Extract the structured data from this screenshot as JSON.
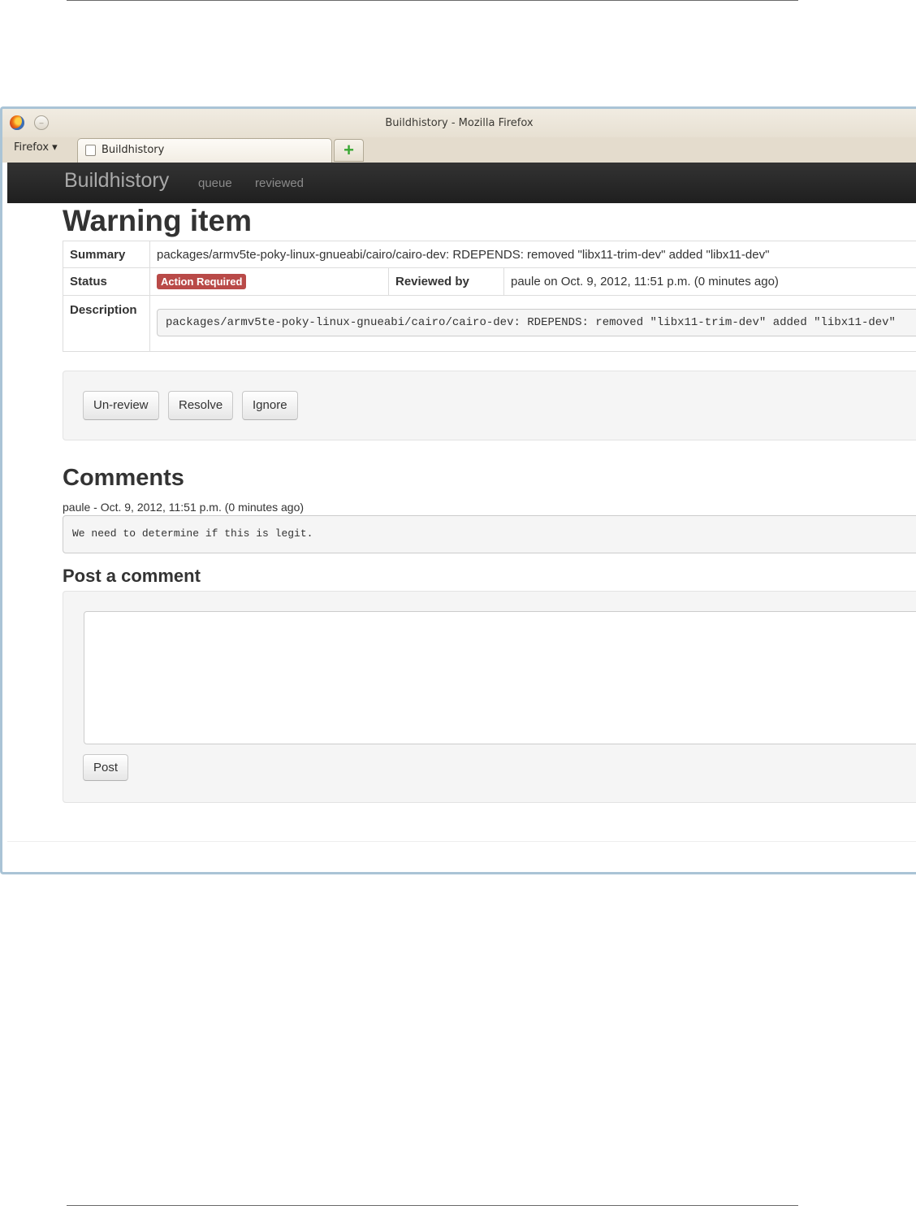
{
  "browser": {
    "window_title": "Buildhistory - Mozilla Firefox",
    "menu_label": "Firefox ▾",
    "tab_title": "Buildhistory",
    "new_tab_glyph": "+"
  },
  "navbar": {
    "brand": "Buildhistory",
    "links": [
      "queue",
      "reviewed"
    ]
  },
  "page": {
    "title": "Warning item",
    "summary_label": "Summary",
    "summary_value": "packages/armv5te-poky-linux-gnueabi/cairo/cairo-dev: RDEPENDS: removed \"libx11-trim-dev\" added \"libx11-dev\"",
    "status_label": "Status",
    "status_value": "Action Required",
    "reviewed_by_label": "Reviewed by",
    "reviewed_by_value": "paule on Oct. 9, 2012, 11:51 p.m. (0 minutes ago)",
    "description_label": "Description",
    "description_value": "packages/armv5te-poky-linux-gnueabi/cairo/cairo-dev: RDEPENDS: removed \"libx11-trim-dev\" added \"libx11-dev\""
  },
  "actions": {
    "unreview": "Un-review",
    "resolve": "Resolve",
    "ignore": "Ignore"
  },
  "comments": {
    "heading": "Comments",
    "items": [
      {
        "meta": "paule - Oct. 9, 2012, 11:51 p.m. (0 minutes ago)",
        "text": "We need to determine if this is legit."
      }
    ]
  },
  "post": {
    "heading": "Post a comment",
    "textarea_value": "",
    "button": "Post"
  },
  "colors": {
    "navbar": "#222222",
    "badge": "#b94a48",
    "window_border": "#aac4d6"
  }
}
